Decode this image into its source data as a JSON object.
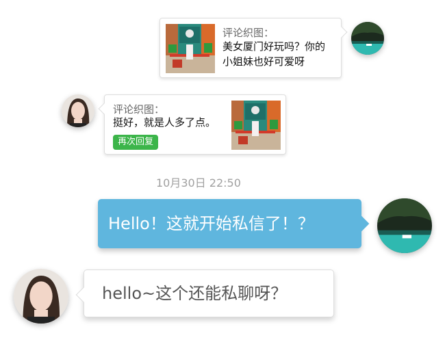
{
  "chat": {
    "message1": {
      "sender": "self",
      "comment_title": "评论织图：",
      "comment_text": "美女厦门好玩吗？你的小姐妹也好可爱呀",
      "thumbnail_icon": "street-photo-thumbnail",
      "avatar_icon": "cave-lake-avatar"
    },
    "message2": {
      "sender": "other",
      "comment_title": "评论织图：",
      "comment_text": "挺好，就是人多了点。",
      "reply_button_label": "再次回复",
      "thumbnail_icon": "street-photo-thumbnail",
      "avatar_icon": "girl-portrait-avatar"
    },
    "timestamp": "10月30日 22:50",
    "message3": {
      "sender": "self",
      "text": "Hello！这就开始私信了！？",
      "bubble_color": "#5fb6de",
      "avatar_icon": "cave-lake-avatar"
    },
    "message4": {
      "sender": "other",
      "text": "hello~这个还能私聊呀？",
      "bubble_color": "#ffffff",
      "avatar_icon": "girl-portrait-avatar"
    }
  },
  "colors": {
    "reply_button": "#3cb54a",
    "timestamp": "#a0a0a0"
  }
}
